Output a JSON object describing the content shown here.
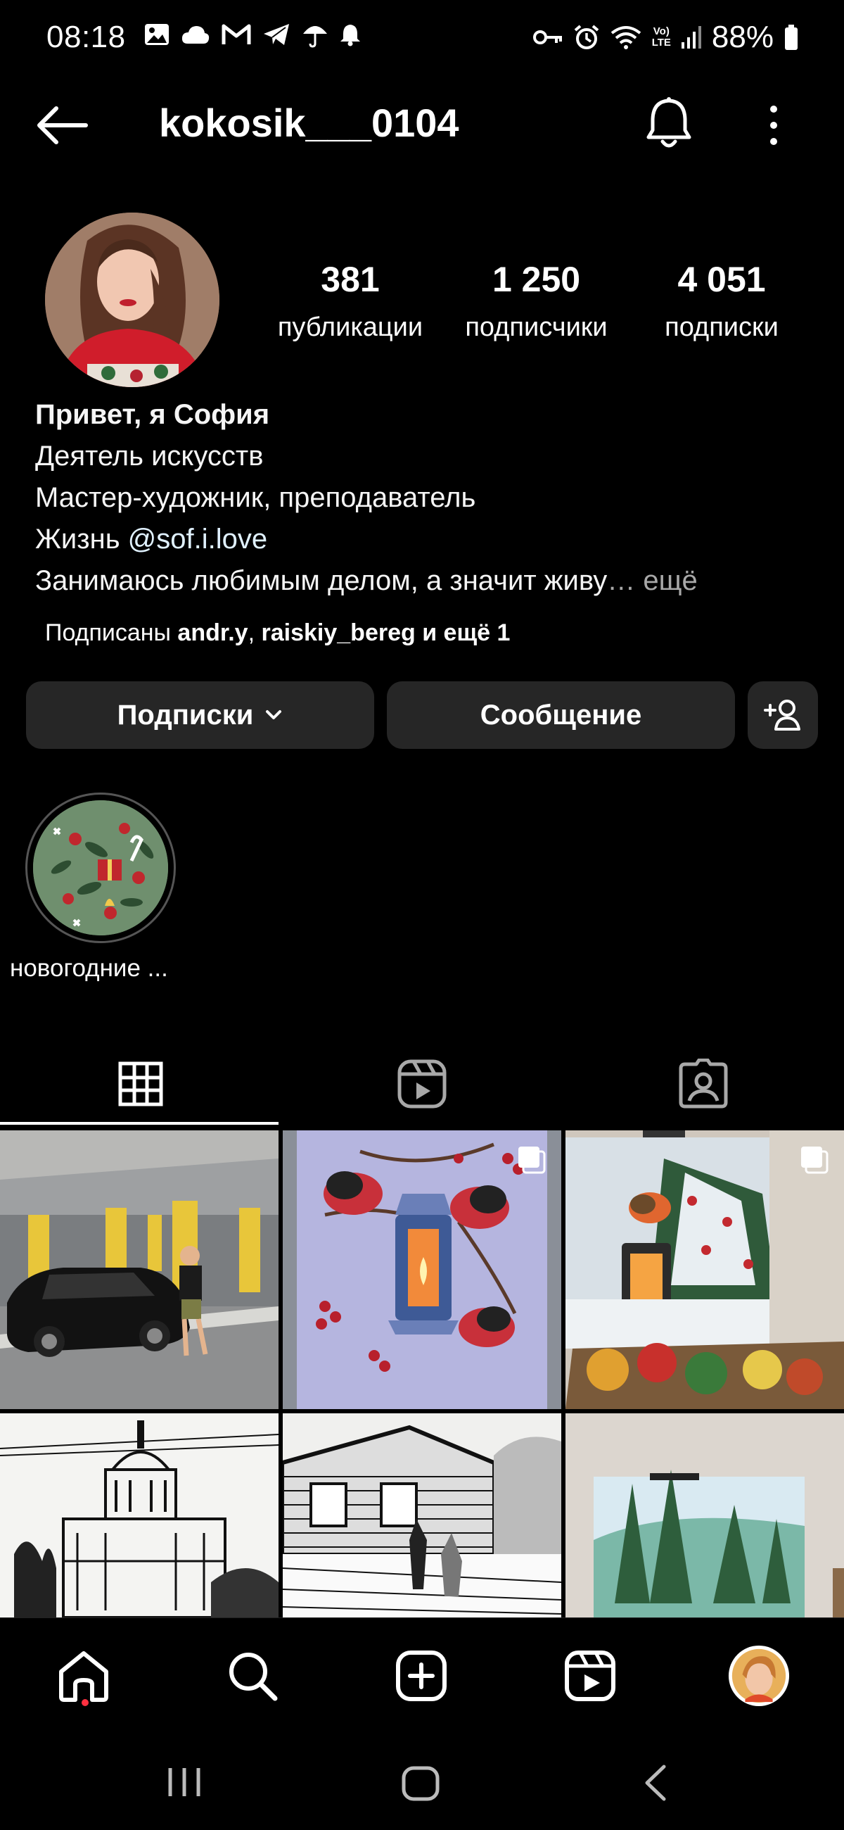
{
  "status_bar": {
    "time": "08:18",
    "battery": "88%",
    "left_icons": [
      "gallery-icon",
      "cloud-icon",
      "gmail-icon",
      "telegram-icon",
      "umbrella-icon",
      "bell-icon"
    ],
    "right_icons": [
      "key-icon",
      "alarm-icon",
      "wifi-icon",
      "volte-icon",
      "signal-icon",
      "battery-icon"
    ],
    "volte_top": "Vo)",
    "volte_bottom": "LTE"
  },
  "header": {
    "username": "kokosik___0104"
  },
  "profile": {
    "stats": [
      {
        "value": "381",
        "label": "публикации"
      },
      {
        "value": "1 250",
        "label": "подписчики"
      },
      {
        "value": "4 051",
        "label": "подписки"
      }
    ],
    "bio": {
      "name": "Привет, я София",
      "category": "Деятель искусств",
      "line1": "Мастер-художник, преподаватель",
      "line2_prefix": "Жизнь ",
      "line2_link": "@sof.i.love",
      "line3": "Занимаюсь любимым делом, а значит живу",
      "more": "… ещё"
    },
    "followed_by": {
      "prefix": "Подписаны ",
      "user1": "andr.y",
      "sep": ", ",
      "user2": "raiskiy_bereg",
      "suffix": " и ещё 1"
    }
  },
  "actions": {
    "following_label": "Подписки",
    "message_label": "Сообщение"
  },
  "highlights": [
    {
      "label": "новогодние ..."
    }
  ],
  "tabs": [
    "grid-icon",
    "reels-icon",
    "tagged-icon"
  ],
  "colors": {
    "background": "#000000",
    "button": "#262626",
    "link": "#e0f1ff",
    "muted": "#a8a8a8",
    "notification_dot": "#ff3040"
  },
  "bottom_nav": [
    "home-icon",
    "search-icon",
    "create-icon",
    "reels-icon",
    "profile-avatar"
  ]
}
